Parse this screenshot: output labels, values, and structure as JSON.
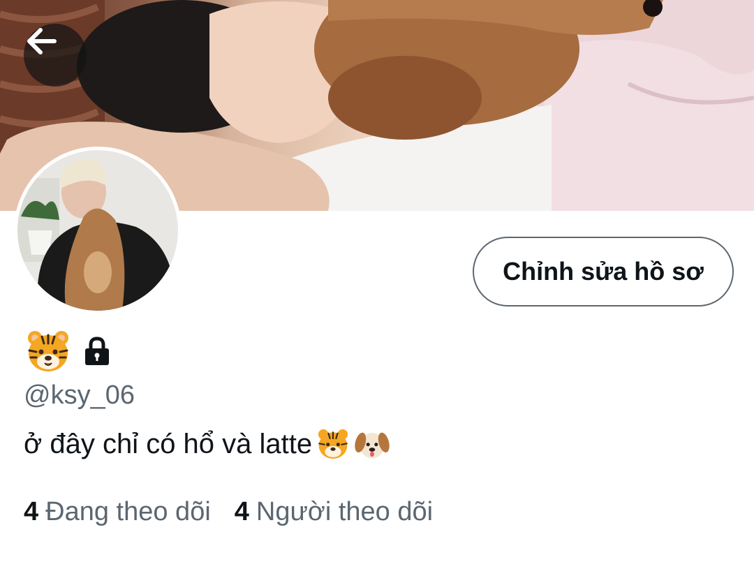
{
  "header": {
    "back_icon": "arrow-left-icon",
    "banner_alt": "profile-banner-photo"
  },
  "profile": {
    "display_name_icon": "tiger-face-emoji",
    "protected_icon": "lock-icon",
    "handle": "@ksy_06",
    "bio_text": "ở đây chỉ có hổ và latte",
    "bio_emojis": [
      "tiger-face-emoji",
      "dog-face-emoji"
    ],
    "edit_button_label": "Chỉnh sửa hồ sơ"
  },
  "stats": {
    "following_count": "4",
    "following_label": "Đang theo dõi",
    "followers_count": "4",
    "followers_label": "Người theo dõi"
  },
  "colors": {
    "primary_text": "#0f1419",
    "secondary_text": "#5b6670",
    "button_border": "#5b6670",
    "background": "#ffffff"
  }
}
